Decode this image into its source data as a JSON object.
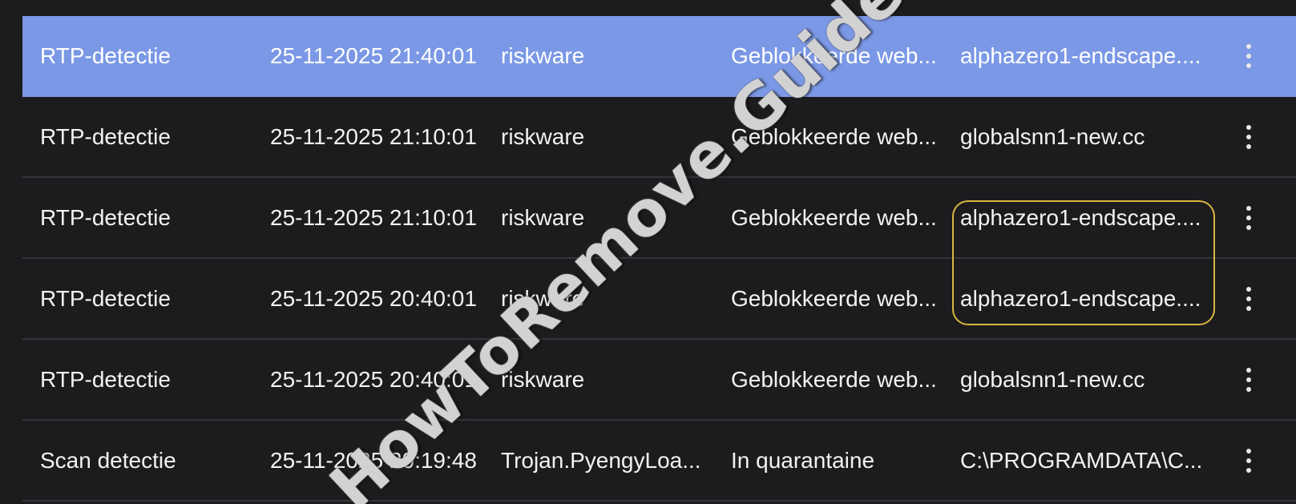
{
  "detections": {
    "rows": [
      {
        "type": "RTP-detectie",
        "date": "25-11-2025 21:40:01",
        "name": "riskware",
        "action": "Geblokkeerde web...",
        "path": "alphazero1-endscape....",
        "selected": true
      },
      {
        "type": "RTP-detectie",
        "date": "25-11-2025 21:10:01",
        "name": "riskware",
        "action": "Geblokkeerde web...",
        "path": "globalsnn1-new.cc",
        "selected": false
      },
      {
        "type": "RTP-detectie",
        "date": "25-11-2025 21:10:01",
        "name": "riskware",
        "action": "Geblokkeerde web...",
        "path": "alphazero1-endscape....",
        "selected": false
      },
      {
        "type": "RTP-detectie",
        "date": "25-11-2025 20:40:01",
        "name": "riskware",
        "action": "Geblokkeerde web...",
        "path": "alphazero1-endscape....",
        "selected": false
      },
      {
        "type": "RTP-detectie",
        "date": "25-11-2025 20:40:01",
        "name": "riskware",
        "action": "Geblokkeerde web...",
        "path": "globalsnn1-new.cc",
        "selected": false
      },
      {
        "type": "Scan detectie",
        "date": "25-11-2025 20:19:48",
        "name": "Trojan.PyengyLoa...",
        "action": "In quarantaine",
        "path": "C:\\PROGRAMDATA\\C...",
        "selected": false
      }
    ],
    "row_menu_icon": "more-vertical-icon"
  },
  "colors": {
    "background": "#1c1c1e",
    "selected_row": "#7b98e6",
    "divider": "#34343a",
    "highlight": "#d9b640"
  },
  "watermark": {
    "text": "HowToRemove.Guide"
  }
}
